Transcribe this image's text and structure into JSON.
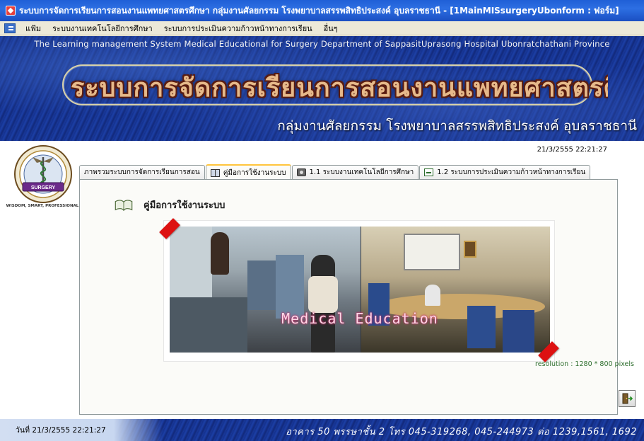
{
  "window": {
    "title": "ระบบการจัดการเรียนการสอนงานแพทยศาสตรศึกษา กลุ่มงานศัลยกรรม โรงพยาบาลสรรพสิทธิประสงค์ อุบลราชธานี - [1MainMISsurgeryUbonform : ฟอร์ม]"
  },
  "menu": {
    "items": [
      {
        "label": "แฟ้ม"
      },
      {
        "label": "ระบบงานเทคโนโลยีการศึกษา"
      },
      {
        "label": "ระบบการประเมินความก้าวหน้าทางการเรียน"
      },
      {
        "label": "อื่นๆ"
      }
    ]
  },
  "banner": {
    "subtitle_en": "The Learning management System Medical Educational for Surgery Department  of SappasitUprasong Hospital Ubonratchathani Province",
    "title_th": "ระบบการจัดการเรียนการสอนงานแพทยศาสตรศึกษา",
    "department": "กลุ่มงานศัลยกรรม โรงพยาบาลสรรพสิทธิประสงค์ อุบลราชธานี"
  },
  "logo": {
    "ribbon": "SURGERY",
    "motto": "WISDOM, SMART, PROFESSIONAL"
  },
  "datetime_top": "21/3/2555 22:21:27",
  "tabs": [
    {
      "label": "ภาพรวมระบบการจัดการเรียนการสอน",
      "icon": "",
      "active": false
    },
    {
      "label": "คู่มือการใช้งานระบบ",
      "icon": "book-icon",
      "active": true
    },
    {
      "label": "1.1 ระบบงานเทคโนโลยีการศึกษา",
      "icon": "camera-icon",
      "active": false
    },
    {
      "label": "1.2 ระบบการประเมินความก้าวหน้าทางการเรียน",
      "icon": "report-icon",
      "active": false
    }
  ],
  "manual": {
    "heading": "คู่มือการใช้งานระบบ",
    "photo_caption": "Medical Education"
  },
  "resolution_note": "resolution : 1280 * 800 pixels",
  "status": {
    "date_label": "วันที่  21/3/2555 22:21:27",
    "address": "อาคาร 50 พรรษาชั้น 2 โทร 045-319268, 045-244973 ต่อ 1239,1561, 1692"
  },
  "colors": {
    "title_bar": "#1f5fd6",
    "banner_blue": "#1a3a9e",
    "banner_title": "#e6b98a",
    "active_tab_accent": "#ffc53d",
    "resolution_text": "#2f6f2f"
  }
}
